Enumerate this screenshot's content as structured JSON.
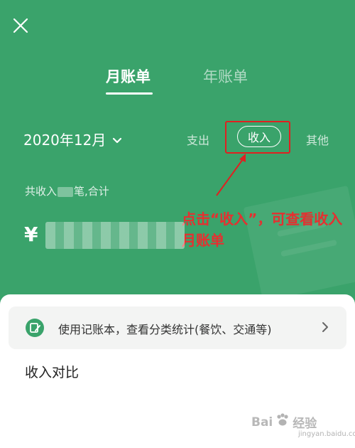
{
  "header": {
    "tabs": [
      {
        "label": "月账单",
        "active": true
      },
      {
        "label": "年账单",
        "active": false
      }
    ]
  },
  "filter": {
    "month": "2020年12月",
    "types": [
      "支出",
      "收入",
      "其他"
    ],
    "selected_type": "收入"
  },
  "summary": {
    "prefix": "共收入",
    "suffix": "笔,合计",
    "currency": "¥"
  },
  "annotation": {
    "text": "点击“收入”，可查看收入月账单"
  },
  "card": {
    "text": "使用记账本，查看分类统计(餐饮、交通等)"
  },
  "section": {
    "title": "收入对比"
  },
  "watermark": {
    "text_left": "Bai",
    "text_right": "经验",
    "sub": "jingyan.baidu.com"
  },
  "colors": {
    "brand_green": "#3aa36b",
    "annotation_red": "#e02020"
  }
}
